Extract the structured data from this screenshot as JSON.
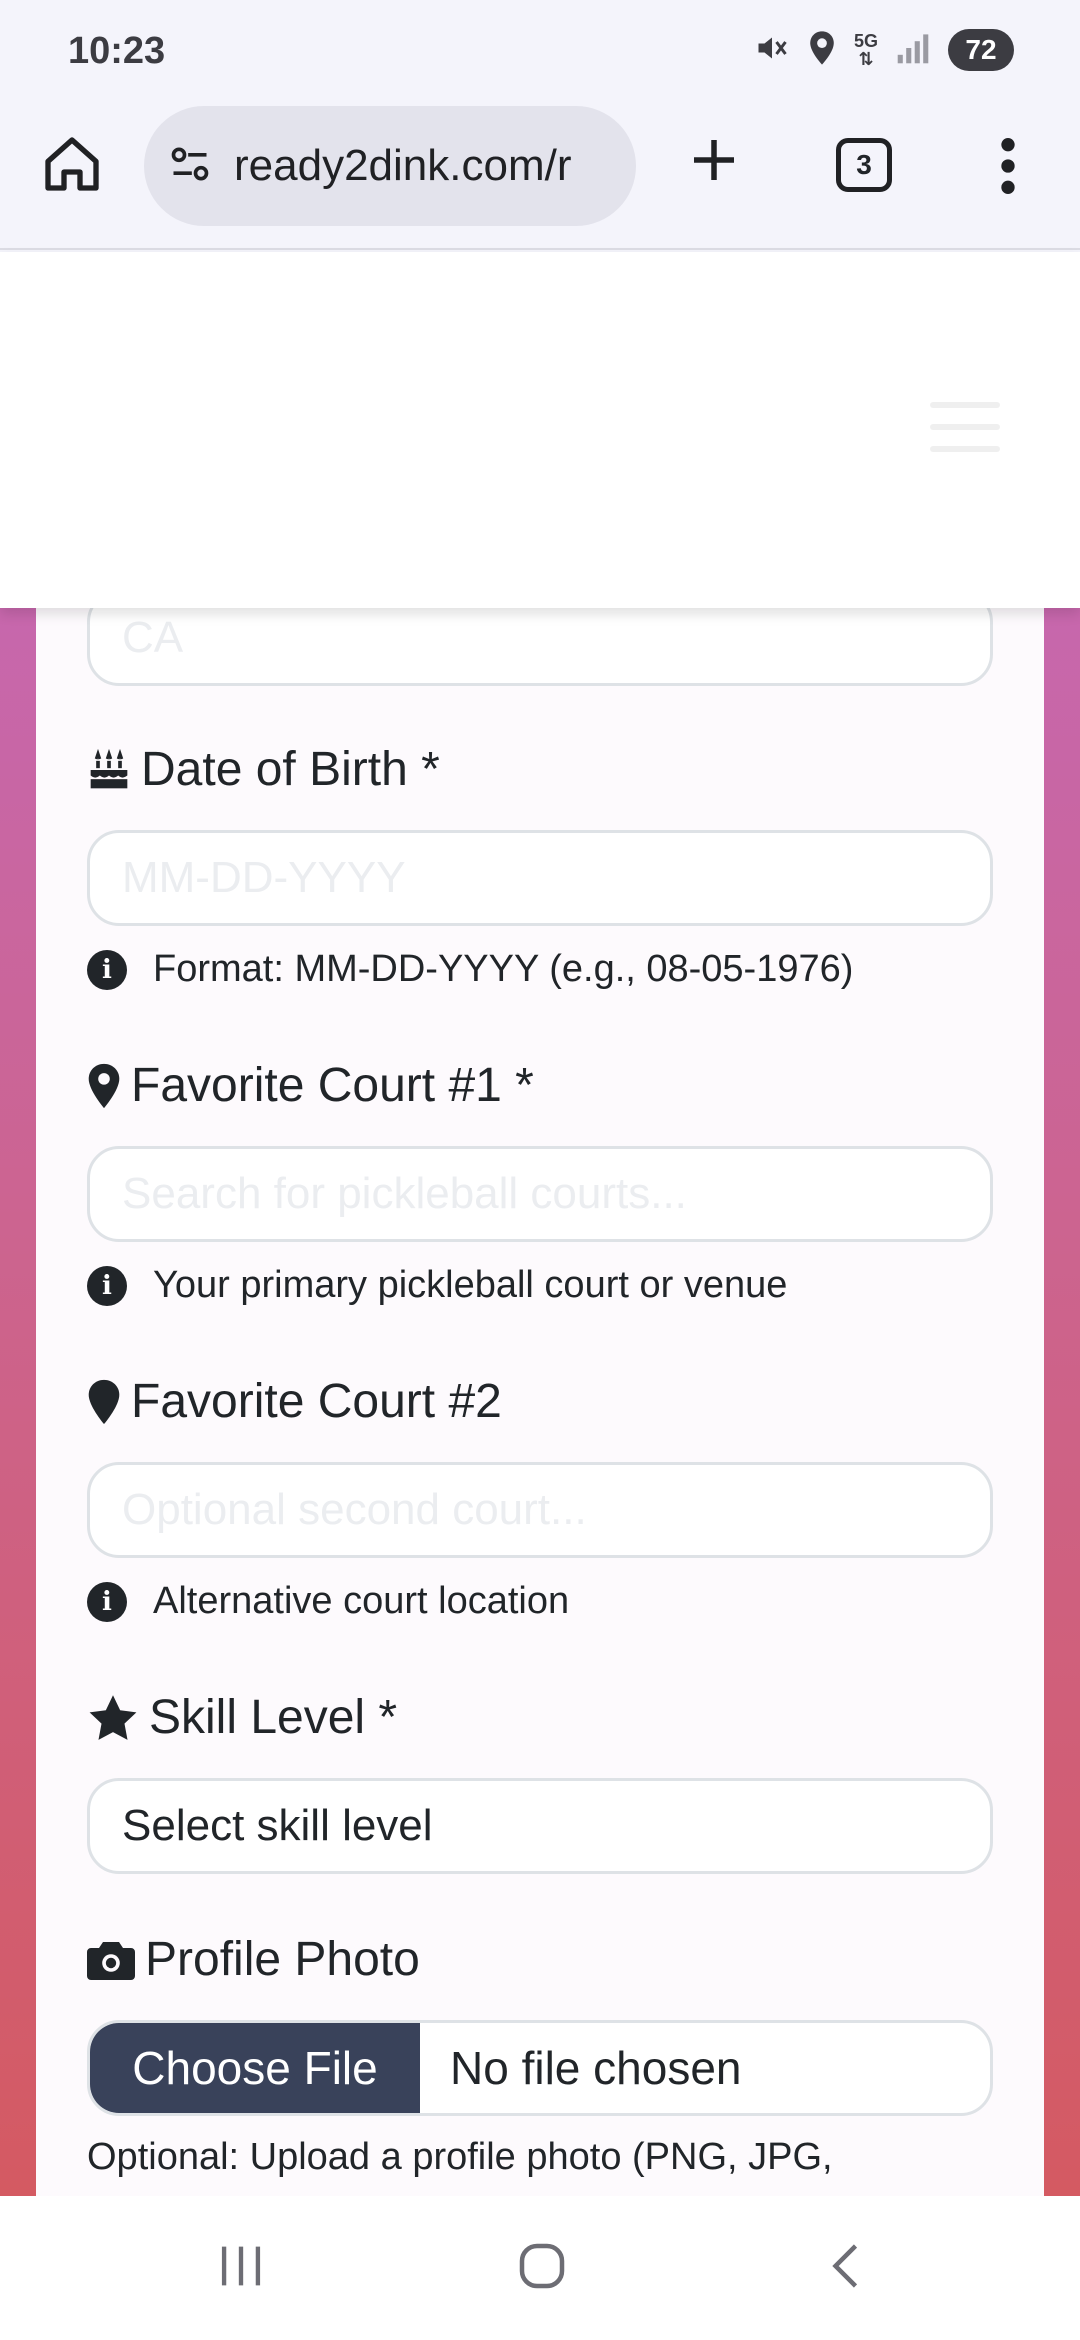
{
  "status_bar": {
    "time": "10:23",
    "network": "5G",
    "battery": "72",
    "icons": [
      "mute-icon",
      "location-icon",
      "5g-icon",
      "signal-icon",
      "battery-icon"
    ]
  },
  "browser": {
    "url": "ready2dink.com/r",
    "tab_count": "3"
  },
  "form": {
    "state_value": "CA",
    "dob": {
      "label": "Date of Birth *",
      "placeholder": "MM-DD-YYYY",
      "help": "Format: MM-DD-YYYY (e.g., 08-05-1976)"
    },
    "court1": {
      "label": "Favorite Court #1 *",
      "placeholder": "Search for pickleball courts...",
      "help": "Your primary pickleball court or venue"
    },
    "court2": {
      "label": "Favorite Court #2",
      "placeholder": "Optional second court...",
      "help": "Alternative court location"
    },
    "skill": {
      "label": "Skill Level *",
      "selected": "Select skill level"
    },
    "photo": {
      "label": "Profile Photo",
      "button": "Choose File",
      "status": "No file chosen",
      "note": "Optional: Upload a profile photo (PNG, JPG,"
    }
  },
  "colors": {
    "gradient_top": "#c469bd",
    "gradient_bottom": "#d45a62",
    "file_button": "#39425a"
  }
}
